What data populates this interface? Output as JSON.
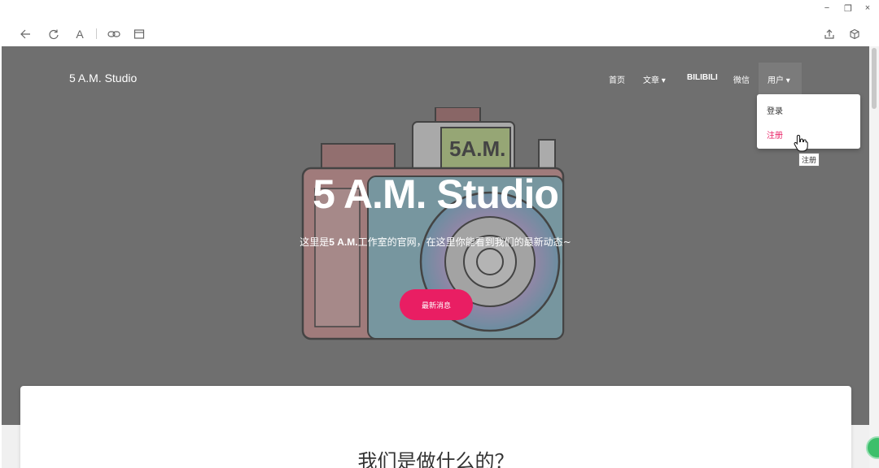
{
  "window": {
    "minimize": "−",
    "restore": "❐",
    "close": "×"
  },
  "toolbar": {
    "back_icon": "arrow-left-icon",
    "reload_icon": "reload-icon",
    "font_label": "A",
    "link_icon": "link-icon",
    "calendar_icon": "calendar-icon",
    "share_icon": "share-icon",
    "extension_icon": "box-icon"
  },
  "navbar": {
    "brand": "5 A.M. Studio",
    "items": [
      {
        "label": "首页"
      },
      {
        "label": "文章 ▾"
      },
      {
        "label": "BILIBILI"
      },
      {
        "label": "微信"
      },
      {
        "label": "用户 ▾"
      }
    ],
    "dropdown": [
      {
        "label": "登录",
        "color": "#333333"
      },
      {
        "label": "注册",
        "color": "#e91e63"
      }
    ],
    "tooltip": "注册"
  },
  "hero": {
    "title": "5 A.M. Studio",
    "subtitle_before": "这里是",
    "subtitle_bold": "5 A.M.",
    "subtitle_after": "工作室的官网，在这里你能看到我们的最新动态~",
    "cta": "最新消息",
    "camera_label": "5A.M."
  },
  "section": {
    "title": "我们是做什么的？"
  },
  "colors": {
    "accent": "#e91e63",
    "hero_overlay": "#6f6f6f"
  }
}
